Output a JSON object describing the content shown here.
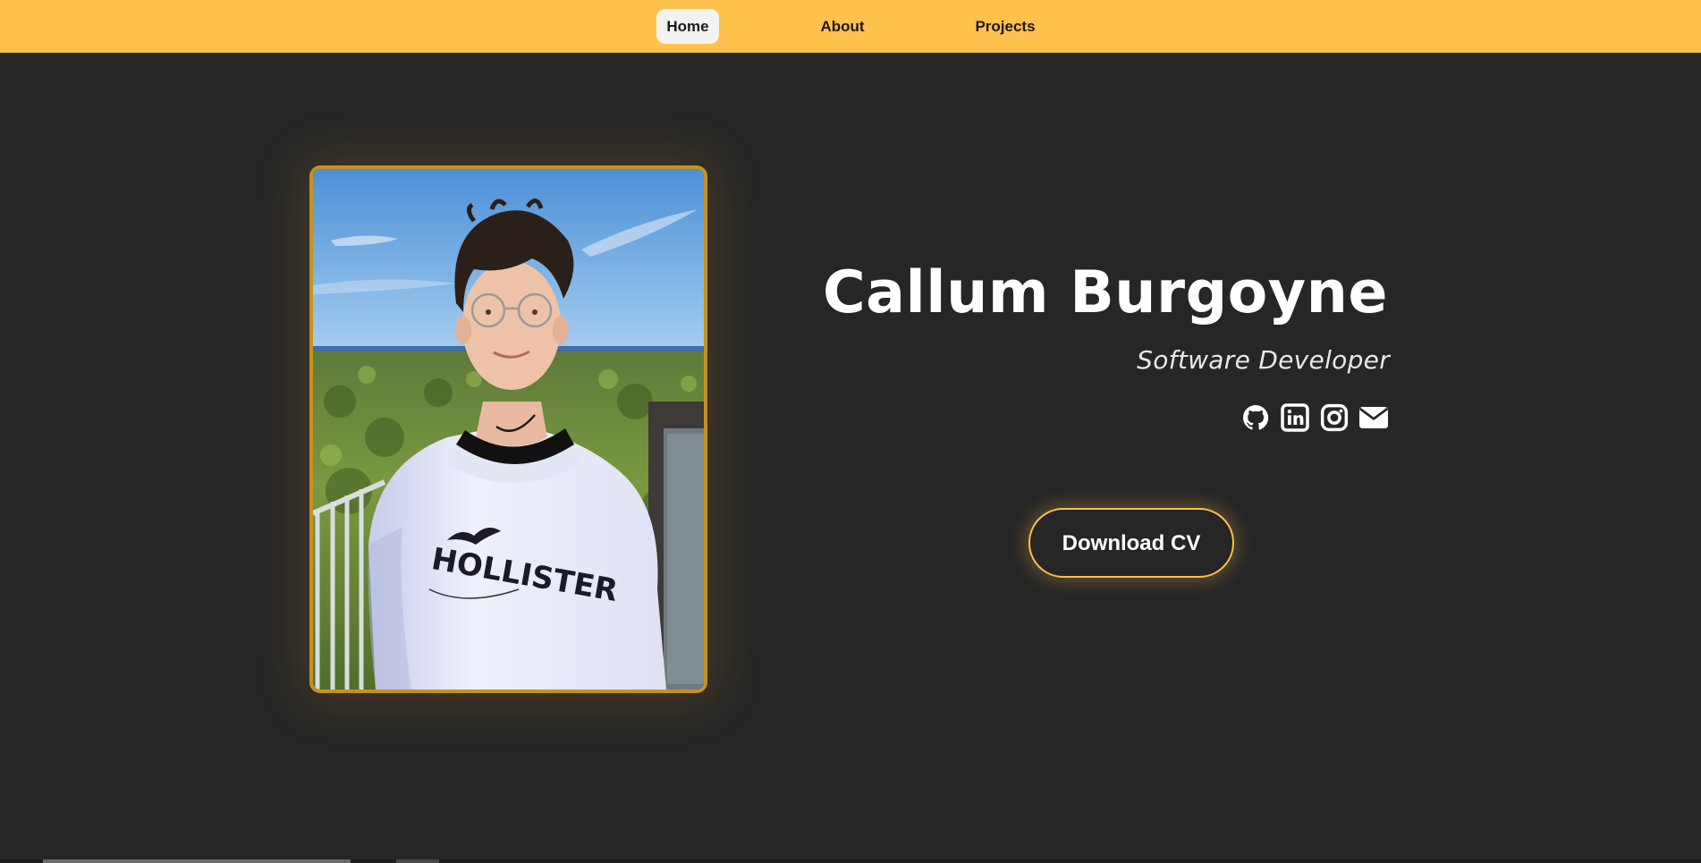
{
  "nav": {
    "home_label": "Home",
    "about_label": "About",
    "projects_label": "Projects",
    "active": "Home",
    "background": "#ffc24d"
  },
  "hero": {
    "name": "Callum Burgoyne",
    "role": "Software Developer",
    "photo_alt": "Profile photo",
    "shirt_text": "HOLLISTER",
    "download_label": "Download CV"
  },
  "socials": [
    {
      "name": "github",
      "icon": "github-icon"
    },
    {
      "name": "linkedin",
      "icon": "linkedin-icon"
    },
    {
      "name": "instagram",
      "icon": "instagram-icon"
    },
    {
      "name": "email",
      "icon": "mail-icon"
    }
  ],
  "colors": {
    "accent": "#ffc24d",
    "background": "#262626",
    "text": "#ffffff"
  }
}
